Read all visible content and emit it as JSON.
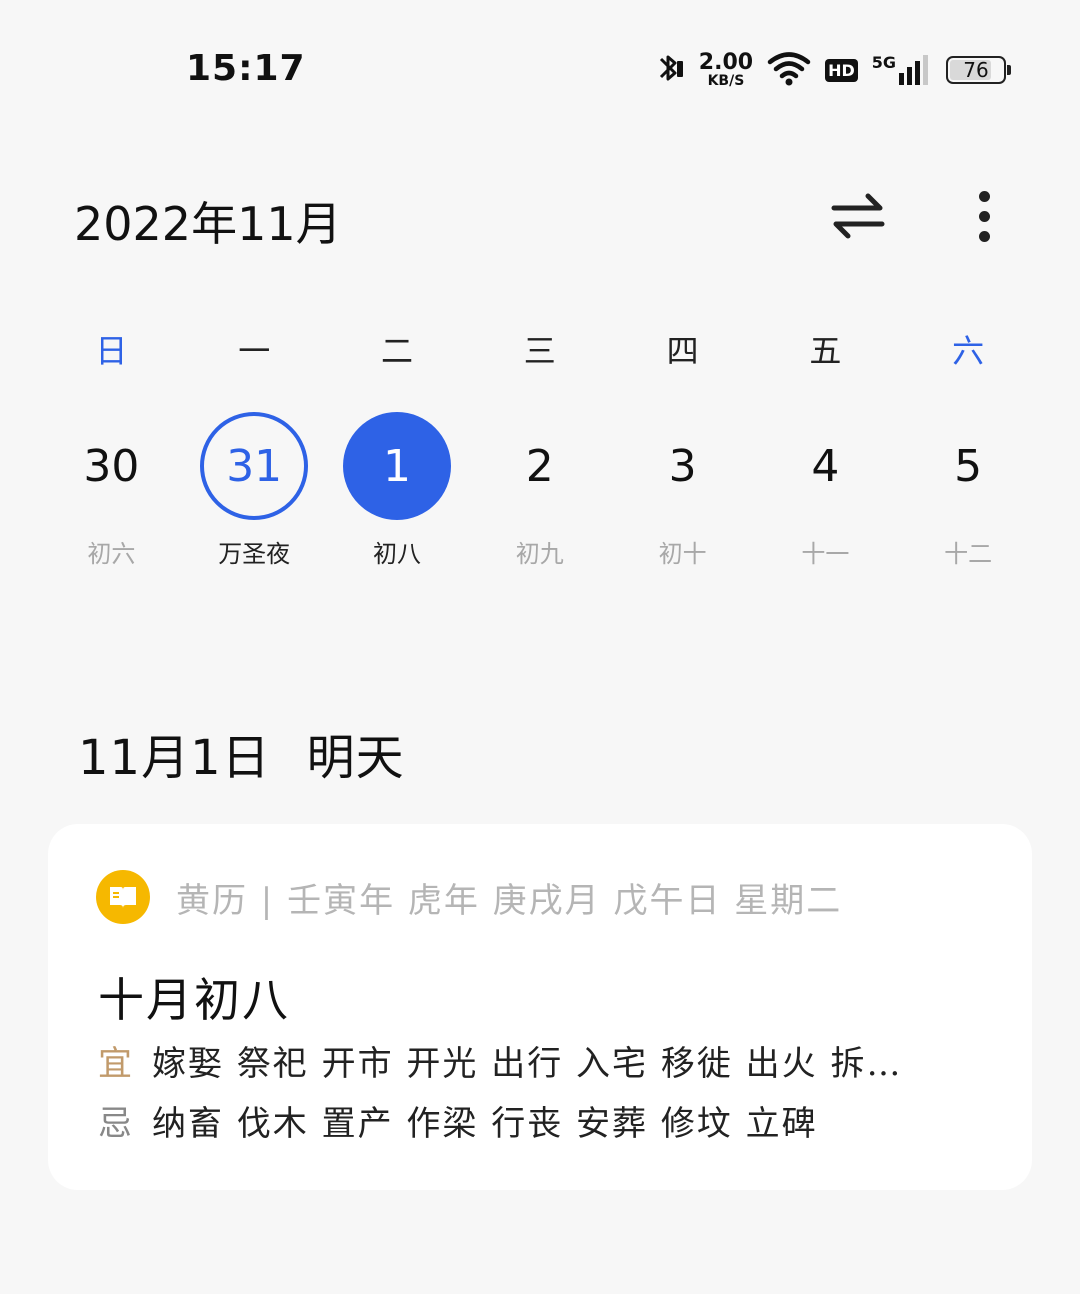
{
  "status_bar": {
    "time": "15:17",
    "net_speed_value": "2.00",
    "net_speed_unit": "KB/S",
    "hd_label": "HD",
    "network_label": "5G",
    "battery_level": "76"
  },
  "header": {
    "month_title": "2022年11月"
  },
  "weekdays": [
    "日",
    "一",
    "二",
    "三",
    "四",
    "五",
    "六"
  ],
  "days": [
    {
      "num": "30",
      "lunar": "初六"
    },
    {
      "num": "31",
      "lunar": "万圣夜"
    },
    {
      "num": "1",
      "lunar": "初八"
    },
    {
      "num": "2",
      "lunar": "初九"
    },
    {
      "num": "3",
      "lunar": "初十"
    },
    {
      "num": "4",
      "lunar": "十一"
    },
    {
      "num": "5",
      "lunar": "十二"
    }
  ],
  "selected": {
    "date": "11月1日",
    "relative": "明天"
  },
  "almanac": {
    "subtitle": "黄历 | 壬寅年 虎年 庚戌月 戊午日 星期二",
    "lunar_date": "十月初八",
    "yi_tag": "宜",
    "yi_items": "嫁娶 祭祀 开市 开光 出行 入宅 移徙 出火 拆…",
    "ji_tag": "忌",
    "ji_items": "纳畜 伐木 置产 作梁 行丧 安葬 修坟 立碑"
  },
  "colors": {
    "accent": "#2e62e6",
    "yi_tag": "#c19a6b",
    "almanac_icon": "#f6b800"
  }
}
